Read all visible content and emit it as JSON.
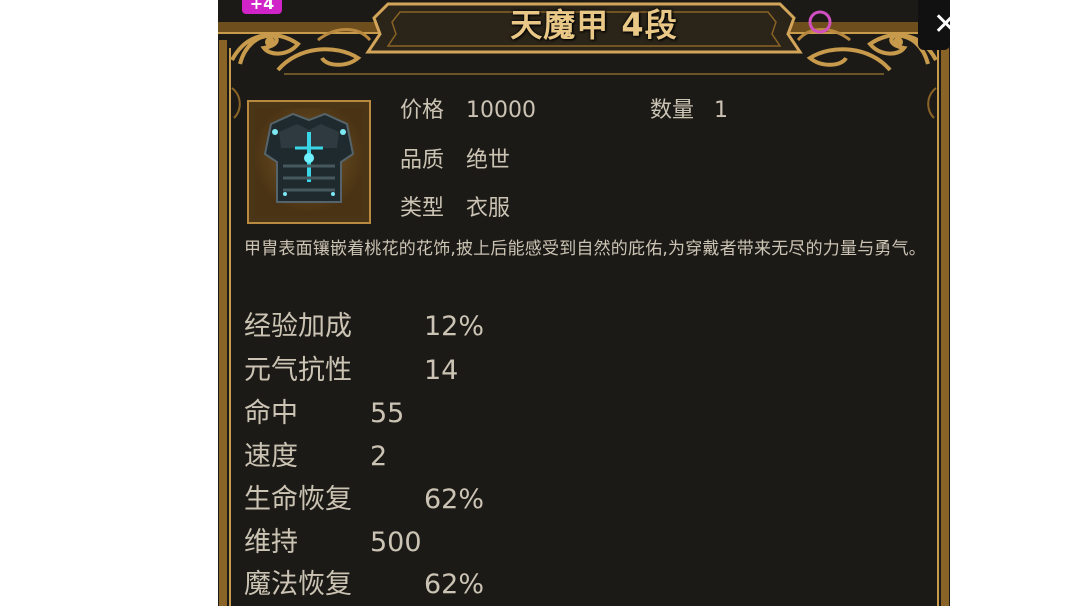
{
  "colors": {
    "panel_bg": "#1c1a17",
    "gold": "#b8893f",
    "title_gold": "#e9c887",
    "text": "#cbc3b3",
    "badge_magenta": "#d024c8"
  },
  "badge": {
    "text": "+4"
  },
  "title": "天魔甲 4段",
  "close": {
    "icon": "close-icon",
    "glyph": "✕"
  },
  "item": {
    "icon_name": "armor-chestplate-icon",
    "price_label": "价格",
    "price": "10000",
    "quantity_label": "数量",
    "quantity": "1",
    "quality_label": "品质",
    "quality": "绝世",
    "type_label": "类型",
    "type": "衣服"
  },
  "description": "甲胄表面镶嵌着桃花的花饰,披上后能感受到自然的庇佑,为穿戴者带来无尽的力量与勇气。",
  "stats": [
    {
      "name": "经验加成",
      "value": "12%"
    },
    {
      "name": "元气抗性",
      "value": "14"
    },
    {
      "name": "命中",
      "value": "55"
    },
    {
      "name": "速度",
      "value": "2"
    },
    {
      "name": "生命恢复",
      "value": "62%"
    },
    {
      "name": "维持",
      "value": "500"
    },
    {
      "name": "魔法恢复",
      "value": "62%"
    }
  ]
}
